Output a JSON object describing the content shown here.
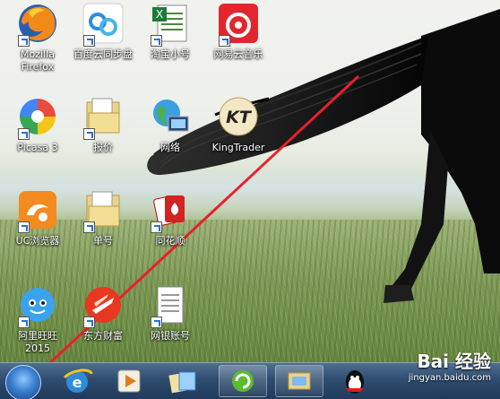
{
  "desktop": {
    "icons": [
      {
        "label": "Mozilla\nFirefox",
        "icon": "firefox-icon"
      },
      {
        "label": "百度云同步盘",
        "icon": "baidu-cloud-icon"
      },
      {
        "label": "淘宝小号",
        "icon": "excel-file-icon"
      },
      {
        "label": "网易云音乐",
        "icon": "netease-music-icon"
      },
      {
        "label": "Picasa 3",
        "icon": "picasa-icon"
      },
      {
        "label": "报价",
        "icon": "folder-icon"
      },
      {
        "label": "网络",
        "icon": "network-globe-icon"
      },
      {
        "label": "KingTrader",
        "icon": "kingtrader-icon"
      },
      {
        "label": "UC浏览器",
        "icon": "uc-browser-icon"
      },
      {
        "label": "单号",
        "icon": "folder-icon"
      },
      {
        "label": "同花顺",
        "icon": "tonghuashun-icon"
      },
      {
        "label": "阿里旺旺\n2015",
        "icon": "aliwangwang-icon"
      },
      {
        "label": "东方财富",
        "icon": "eastmoney-icon"
      },
      {
        "label": "网银账号",
        "icon": "text-document-icon"
      }
    ],
    "icon_text": {
      "kt": "KT"
    }
  },
  "taskbar": {
    "items": [
      "start-orb",
      "ie-icon",
      "media-player-icon",
      "file-manager-icon",
      "green-refresh-icon",
      "explorer-icon",
      "qq-icon"
    ]
  },
  "watermark": {
    "logo": "Bai 经验",
    "url": "jingyan.baidu.com"
  },
  "colors": {
    "annotation_line": "#e8212b",
    "taskbar": "#2f4d70"
  }
}
